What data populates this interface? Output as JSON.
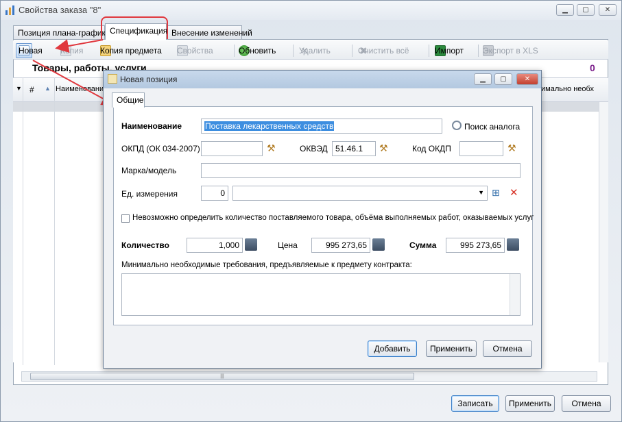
{
  "window": {
    "title": "Свойства заказа \"8\"",
    "controls": {
      "minimize": "▁",
      "maximize": "▢",
      "close": "✕"
    }
  },
  "tabs": [
    {
      "label": "Позиция плана-графика"
    },
    {
      "label": "Спецификация"
    },
    {
      "label": "Внесение изменений"
    }
  ],
  "toolbar": {
    "new": "Новая",
    "copy": "Копия",
    "copy_subject": "Копия предмета",
    "properties": "Свойства",
    "refresh": "Обновить",
    "delete": "Удалить",
    "clear_all": "Очистить всё",
    "import": "Импорт",
    "export": "Экспорт в XLS"
  },
  "section": {
    "title": "Товары, работы, услуги",
    "count": "0"
  },
  "grid": {
    "columns": [
      "#",
      "Наименование",
      "имально необх"
    ]
  },
  "footer": {
    "save": "Записать",
    "apply": "Применить",
    "cancel": "Отмена"
  },
  "dialog": {
    "title": "Новая позиция",
    "tab": "Общие",
    "name_label": "Наименование",
    "name_value": "Поставка лекарственных средств",
    "search_analog": "Поиск аналога",
    "okpd_label": "ОКПД (ОК 034-2007)",
    "okpd_value": "",
    "okved_label": "ОКВЭД",
    "okved_value": "51.46.1",
    "okdp_label": "Код ОКДП",
    "okdp_value": "",
    "brand_label": "Марка/модель",
    "brand_value": "",
    "unit_label": "Ед. измерения",
    "unit_code": "0",
    "unit_value": "",
    "cannot_determine": "Невозможно определить количество поставляемого товара, объёма выполняемых работ, оказываемых услуг",
    "qty_label": "Количество",
    "qty_value": "1,000",
    "price_label": "Цена",
    "price_value": "995 273,65",
    "sum_label": "Сумма",
    "sum_value": "995 273,65",
    "requirements_label": "Минимально необходимые требования, предъявляемые к предмету контракта:",
    "requirements_value": "",
    "add": "Добавить",
    "apply": "Применить",
    "cancel": "Отмена"
  },
  "colors": {
    "accent": "#3c7fc8",
    "annotation": "#e0383e",
    "count": "#7a1d8a"
  }
}
